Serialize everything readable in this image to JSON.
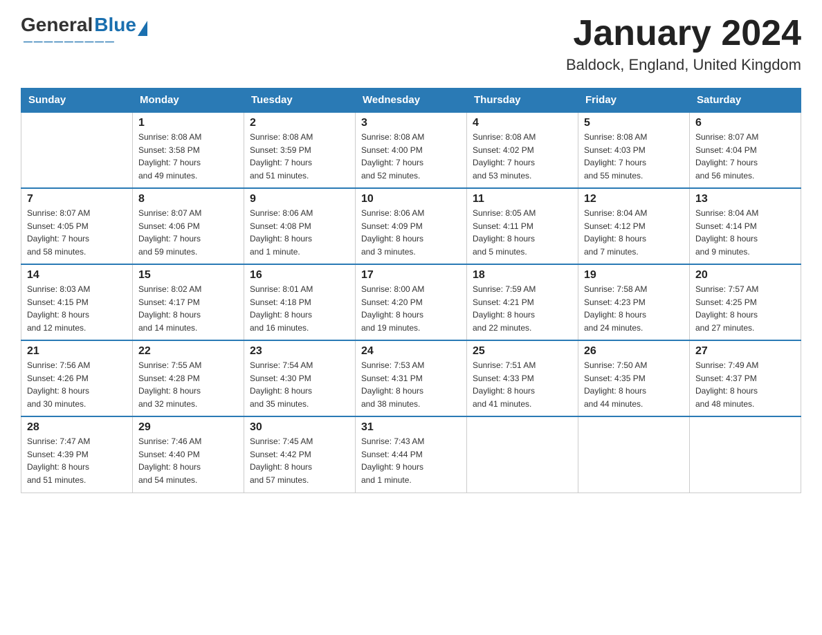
{
  "logo": {
    "general": "General",
    "blue": "Blue"
  },
  "title": "January 2024",
  "location": "Baldock, England, United Kingdom",
  "days_header": [
    "Sunday",
    "Monday",
    "Tuesday",
    "Wednesday",
    "Thursday",
    "Friday",
    "Saturday"
  ],
  "weeks": [
    [
      {
        "num": "",
        "info": ""
      },
      {
        "num": "1",
        "info": "Sunrise: 8:08 AM\nSunset: 3:58 PM\nDaylight: 7 hours\nand 49 minutes."
      },
      {
        "num": "2",
        "info": "Sunrise: 8:08 AM\nSunset: 3:59 PM\nDaylight: 7 hours\nand 51 minutes."
      },
      {
        "num": "3",
        "info": "Sunrise: 8:08 AM\nSunset: 4:00 PM\nDaylight: 7 hours\nand 52 minutes."
      },
      {
        "num": "4",
        "info": "Sunrise: 8:08 AM\nSunset: 4:02 PM\nDaylight: 7 hours\nand 53 minutes."
      },
      {
        "num": "5",
        "info": "Sunrise: 8:08 AM\nSunset: 4:03 PM\nDaylight: 7 hours\nand 55 minutes."
      },
      {
        "num": "6",
        "info": "Sunrise: 8:07 AM\nSunset: 4:04 PM\nDaylight: 7 hours\nand 56 minutes."
      }
    ],
    [
      {
        "num": "7",
        "info": "Sunrise: 8:07 AM\nSunset: 4:05 PM\nDaylight: 7 hours\nand 58 minutes."
      },
      {
        "num": "8",
        "info": "Sunrise: 8:07 AM\nSunset: 4:06 PM\nDaylight: 7 hours\nand 59 minutes."
      },
      {
        "num": "9",
        "info": "Sunrise: 8:06 AM\nSunset: 4:08 PM\nDaylight: 8 hours\nand 1 minute."
      },
      {
        "num": "10",
        "info": "Sunrise: 8:06 AM\nSunset: 4:09 PM\nDaylight: 8 hours\nand 3 minutes."
      },
      {
        "num": "11",
        "info": "Sunrise: 8:05 AM\nSunset: 4:11 PM\nDaylight: 8 hours\nand 5 minutes."
      },
      {
        "num": "12",
        "info": "Sunrise: 8:04 AM\nSunset: 4:12 PM\nDaylight: 8 hours\nand 7 minutes."
      },
      {
        "num": "13",
        "info": "Sunrise: 8:04 AM\nSunset: 4:14 PM\nDaylight: 8 hours\nand 9 minutes."
      }
    ],
    [
      {
        "num": "14",
        "info": "Sunrise: 8:03 AM\nSunset: 4:15 PM\nDaylight: 8 hours\nand 12 minutes."
      },
      {
        "num": "15",
        "info": "Sunrise: 8:02 AM\nSunset: 4:17 PM\nDaylight: 8 hours\nand 14 minutes."
      },
      {
        "num": "16",
        "info": "Sunrise: 8:01 AM\nSunset: 4:18 PM\nDaylight: 8 hours\nand 16 minutes."
      },
      {
        "num": "17",
        "info": "Sunrise: 8:00 AM\nSunset: 4:20 PM\nDaylight: 8 hours\nand 19 minutes."
      },
      {
        "num": "18",
        "info": "Sunrise: 7:59 AM\nSunset: 4:21 PM\nDaylight: 8 hours\nand 22 minutes."
      },
      {
        "num": "19",
        "info": "Sunrise: 7:58 AM\nSunset: 4:23 PM\nDaylight: 8 hours\nand 24 minutes."
      },
      {
        "num": "20",
        "info": "Sunrise: 7:57 AM\nSunset: 4:25 PM\nDaylight: 8 hours\nand 27 minutes."
      }
    ],
    [
      {
        "num": "21",
        "info": "Sunrise: 7:56 AM\nSunset: 4:26 PM\nDaylight: 8 hours\nand 30 minutes."
      },
      {
        "num": "22",
        "info": "Sunrise: 7:55 AM\nSunset: 4:28 PM\nDaylight: 8 hours\nand 32 minutes."
      },
      {
        "num": "23",
        "info": "Sunrise: 7:54 AM\nSunset: 4:30 PM\nDaylight: 8 hours\nand 35 minutes."
      },
      {
        "num": "24",
        "info": "Sunrise: 7:53 AM\nSunset: 4:31 PM\nDaylight: 8 hours\nand 38 minutes."
      },
      {
        "num": "25",
        "info": "Sunrise: 7:51 AM\nSunset: 4:33 PM\nDaylight: 8 hours\nand 41 minutes."
      },
      {
        "num": "26",
        "info": "Sunrise: 7:50 AM\nSunset: 4:35 PM\nDaylight: 8 hours\nand 44 minutes."
      },
      {
        "num": "27",
        "info": "Sunrise: 7:49 AM\nSunset: 4:37 PM\nDaylight: 8 hours\nand 48 minutes."
      }
    ],
    [
      {
        "num": "28",
        "info": "Sunrise: 7:47 AM\nSunset: 4:39 PM\nDaylight: 8 hours\nand 51 minutes."
      },
      {
        "num": "29",
        "info": "Sunrise: 7:46 AM\nSunset: 4:40 PM\nDaylight: 8 hours\nand 54 minutes."
      },
      {
        "num": "30",
        "info": "Sunrise: 7:45 AM\nSunset: 4:42 PM\nDaylight: 8 hours\nand 57 minutes."
      },
      {
        "num": "31",
        "info": "Sunrise: 7:43 AM\nSunset: 4:44 PM\nDaylight: 9 hours\nand 1 minute."
      },
      {
        "num": "",
        "info": ""
      },
      {
        "num": "",
        "info": ""
      },
      {
        "num": "",
        "info": ""
      }
    ]
  ]
}
